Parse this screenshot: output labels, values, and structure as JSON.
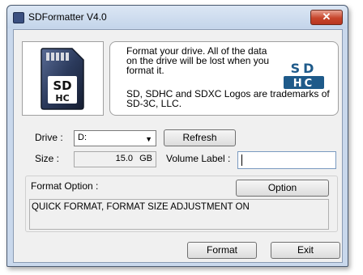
{
  "window": {
    "title": "SDFormatter V4.0",
    "close_glyph": "✕"
  },
  "info": {
    "lines": [
      "Format your drive. All of the data",
      "on the drive will be lost when you",
      "format it."
    ],
    "trademark_lines": [
      "SD, SDHC and SDXC Logos are trademarks of",
      "SD-3C, LLC."
    ],
    "logo_text": "SD HC"
  },
  "drive": {
    "label": "Drive :",
    "value": "D:",
    "refresh_label": "Refresh"
  },
  "size": {
    "label": "Size  :",
    "value": "15.0",
    "unit": "GB"
  },
  "volume": {
    "label": "Volume Label  :",
    "value": ""
  },
  "format_option": {
    "label": "Format Option :",
    "option_button": "Option",
    "current": "QUICK FORMAT, FORMAT SIZE ADJUSTMENT ON"
  },
  "actions": {
    "format_label": "Format",
    "exit_label": "Exit"
  },
  "colors": {
    "sd_blue": "#1e5a8a",
    "card_dark": "#2b3a5c",
    "close_red": "#c7452b"
  }
}
